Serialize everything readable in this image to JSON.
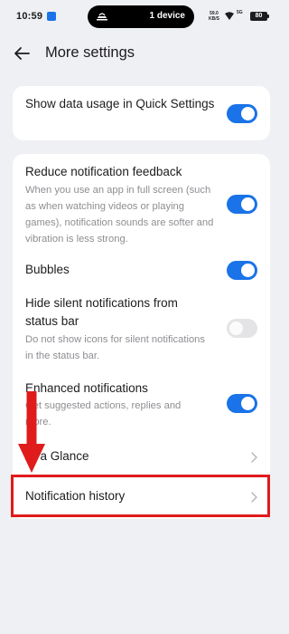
{
  "status_bar": {
    "time": "10:59",
    "island_text": "1 device",
    "net_speed": "59.0",
    "net_unit": "KB/S",
    "battery": "80",
    "signal": "5G",
    "app_icon": "notification-app-icon"
  },
  "header": {
    "title": "More settings",
    "back_icon": "back-arrow-icon"
  },
  "quick_settings_card": {
    "items": [
      {
        "title": "Show data usage in Quick Settings",
        "toggle": "on"
      }
    ]
  },
  "notification_card": {
    "items": [
      {
        "title": "Reduce notification feedback",
        "description": "When you use an app in full screen (such as when watching videos or playing games), notification sounds are softer and vibration is less strong.",
        "toggle": "on"
      },
      {
        "title": "Bubbles",
        "toggle": "on"
      },
      {
        "title": "Hide silent notifications from status bar",
        "description": "Do not show icons for silent notifications in the status bar.",
        "toggle": "off"
      },
      {
        "title": "Enhanced notifications",
        "description": "Get suggested actions, replies and more.",
        "toggle": "on"
      },
      {
        "title": "At a Glance",
        "control": "chevron"
      },
      {
        "title": "Notification history",
        "control": "chevron"
      }
    ]
  },
  "colors": {
    "accent": "#1a73e8",
    "background": "#eff0f3",
    "annotation": "#e01b1b"
  }
}
